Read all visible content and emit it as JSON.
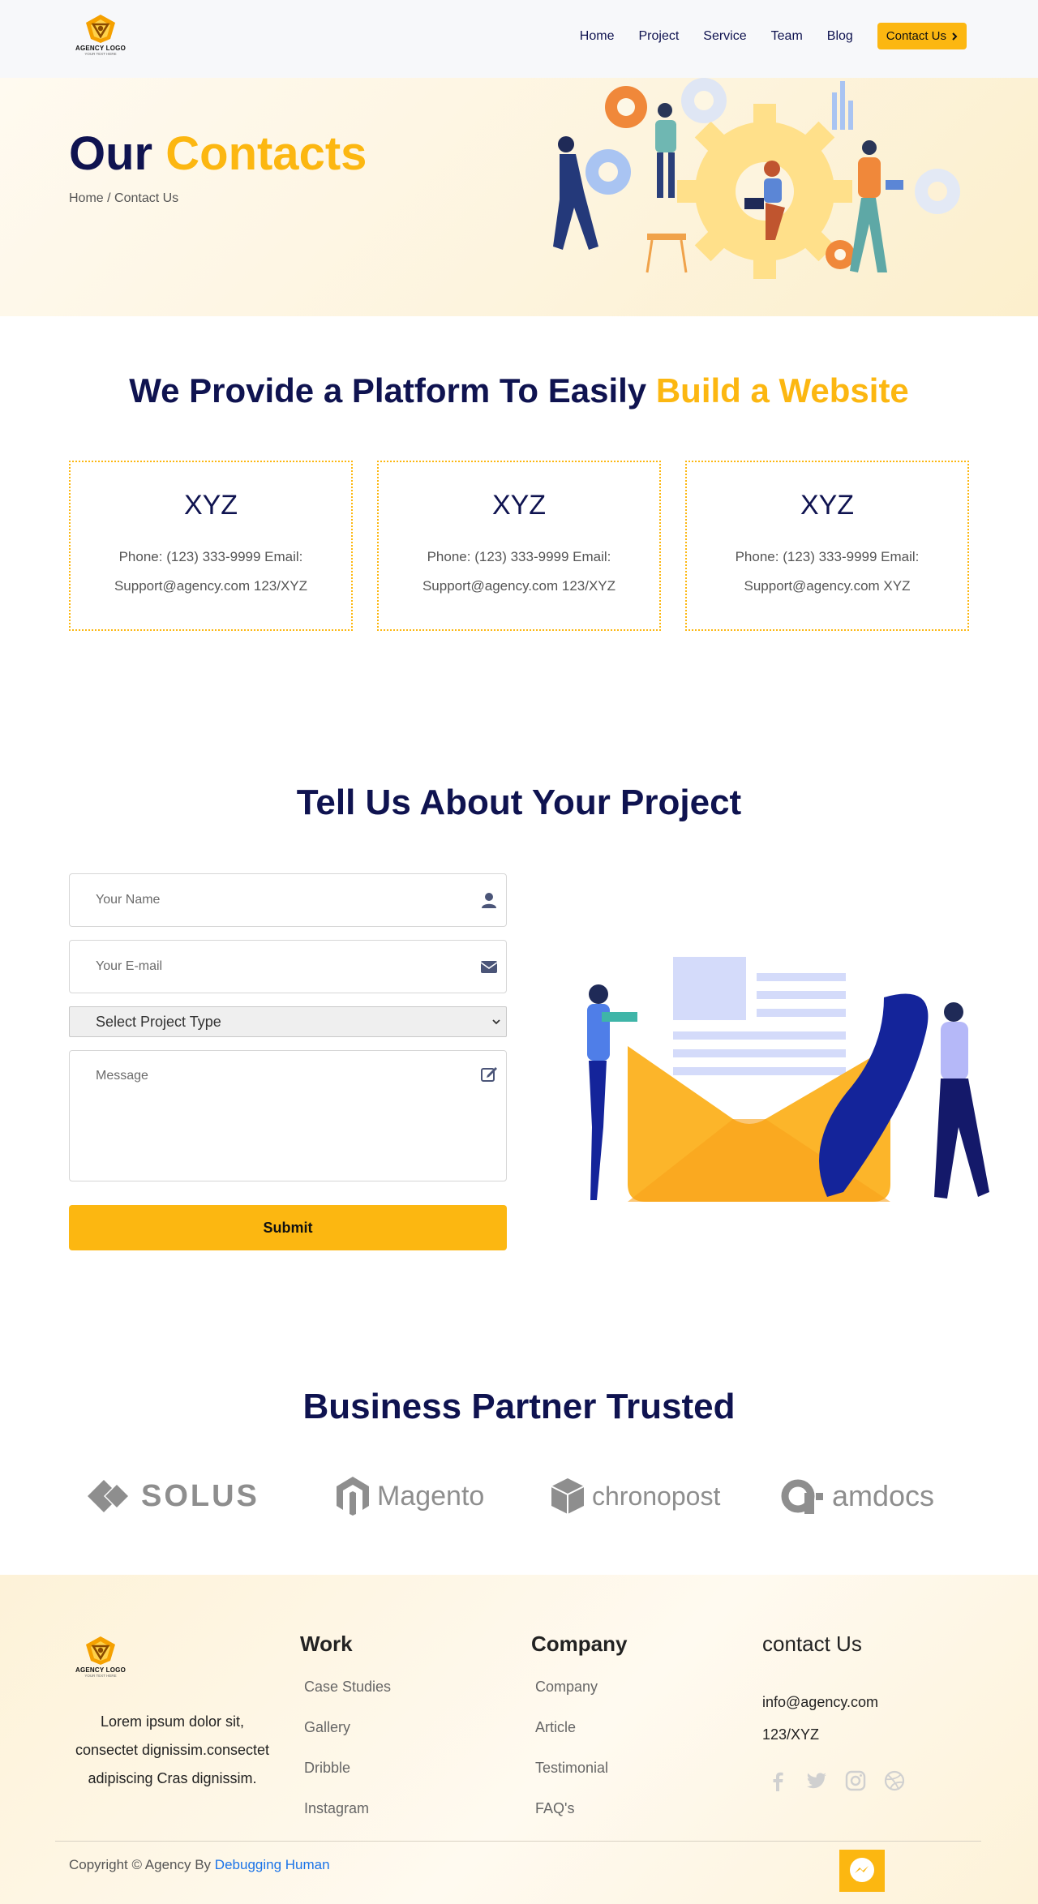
{
  "nav": {
    "logo": {
      "name": "AGENCY LOGO",
      "tagline": "YOUR TEXT HERE"
    },
    "links": [
      "Home",
      "Project",
      "Service",
      "Team",
      "Blog"
    ],
    "cta": "Contact Us"
  },
  "hero": {
    "title_main": "Our",
    "title_accent": "Contacts",
    "breadcrumb": "Home / Contact Us"
  },
  "platform": {
    "title_main": "We Provide a Platform To Easily",
    "title_accent": "Build a Website",
    "cards": [
      {
        "title": "XYZ",
        "text": "Phone: (123) 333-9999 Email: Support@agency.com 123/XYZ"
      },
      {
        "title": "XYZ",
        "text": "Phone: (123) 333-9999 Email: Support@agency.com 123/XYZ"
      },
      {
        "title": "XYZ",
        "text": "Phone: (123) 333-9999 Email: Support@agency.com XYZ"
      }
    ]
  },
  "form": {
    "title": "Tell Us About Your Project",
    "name_placeholder": "Your Name",
    "email_placeholder": "Your E-mail",
    "select_value": "Select Project Type",
    "message_placeholder": "Message",
    "submit": "Submit",
    "icons": [
      "user-icon",
      "envelope-icon",
      "edit-icon"
    ]
  },
  "partners": {
    "title": "Business Partner Trusted",
    "logos": [
      "SOLUS",
      "Magento",
      "chronopost",
      "amdocs"
    ]
  },
  "footer": {
    "logo": {
      "name": "AGENCY LOGO",
      "tagline": "YOUR TEXT HERE"
    },
    "about": "Lorem ipsum dolor sit, consectet dignissim.consectet adipiscing Cras dignissim.",
    "work": {
      "heading": "Work",
      "links": [
        "Case Studies",
        "Gallery",
        "Dribble",
        "Instagram"
      ]
    },
    "company": {
      "heading": "Company",
      "links": [
        "Company",
        "Article",
        "Testimonial",
        "FAQ's"
      ]
    },
    "contact": {
      "heading": "contact Us",
      "email": "info@agency.com",
      "address": "123/XYZ"
    },
    "socials": [
      "facebook-icon",
      "twitter-icon",
      "instagram-icon",
      "dribbble-icon"
    ],
    "copyright_prefix": "Copyright © Agency By",
    "copyright_link": "Debugging Human"
  },
  "colors": {
    "accent": "#fcb711",
    "navy": "#0f1350",
    "link": "#1a73e8"
  }
}
